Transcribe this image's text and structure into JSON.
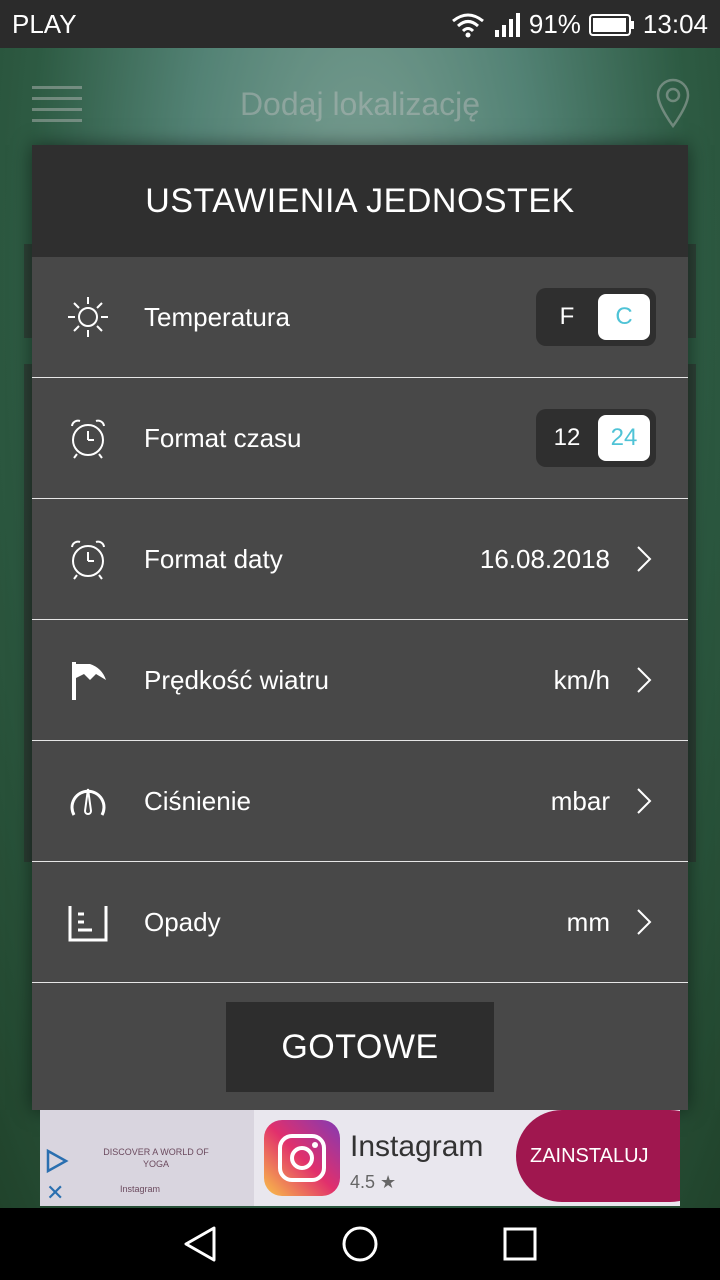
{
  "status_bar": {
    "carrier": "PLAY",
    "battery": "91%",
    "time": "13:04"
  },
  "background": {
    "title": "Dodaj lokalizację"
  },
  "dialog": {
    "title": "USTAWIENIA JEDNOSTEK",
    "rows": [
      {
        "label": "Temperatura",
        "icon": "sun-icon",
        "toggle": {
          "off": "F",
          "on": "C"
        }
      },
      {
        "label": "Format czasu",
        "icon": "alarm-clock-icon",
        "toggle": {
          "off": "12",
          "on": "24"
        }
      },
      {
        "label": "Format daty",
        "icon": "alarm-clock-icon",
        "value": "16.08.2018"
      },
      {
        "label": "Prędkość wiatru",
        "icon": "wind-flag-icon",
        "value": "km/h"
      },
      {
        "label": "Ciśnienie",
        "icon": "pressure-gauge-icon",
        "value": "mbar"
      },
      {
        "label": "Opady",
        "icon": "rain-gauge-icon",
        "value": "mm"
      }
    ],
    "done_label": "GOTOWE",
    "accent_color": "#4fc3d6"
  },
  "ad": {
    "promo_text": "DISCOVER A WORLD OF YOGA",
    "promo_brand": "Instagram",
    "app_name": "Instagram",
    "rating": "4.5",
    "install_label": "ZAINSTALUJ"
  }
}
